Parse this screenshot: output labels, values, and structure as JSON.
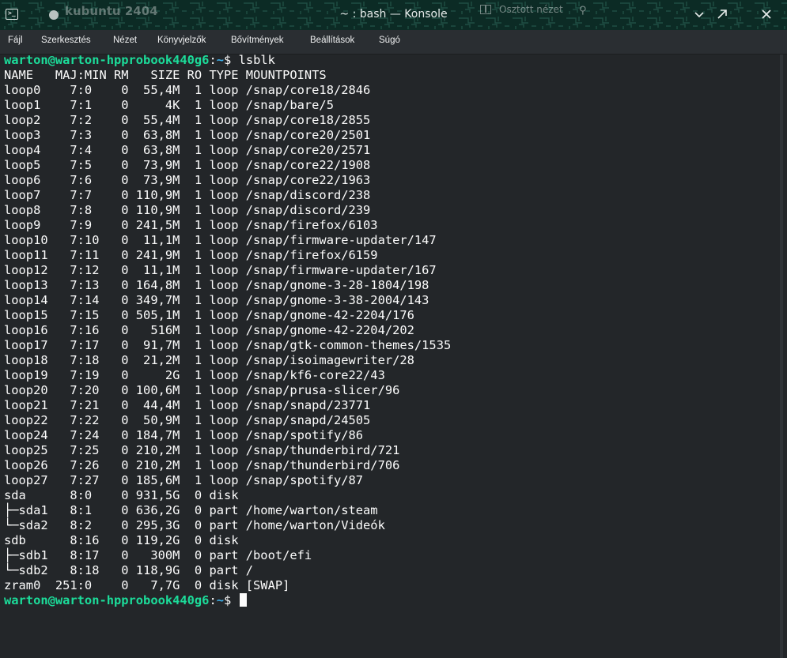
{
  "titlebar": {
    "ghost_text": "kubuntu 2404",
    "title": "~ : bash — Konsole",
    "split_view_label": "Osztott nézet"
  },
  "menu": {
    "items": [
      "Fájl",
      "Szerkesztés",
      "Nézet",
      "Könyvjelzők",
      "Bővítmények",
      "Beállítások",
      "Súgó"
    ]
  },
  "terminal": {
    "prompt_user": "warton@warton-hpprobook440g6",
    "prompt_path": "~",
    "prompt_symbol": "$",
    "command": "lsblk",
    "output": [
      "NAME   MAJ:MIN RM   SIZE RO TYPE MOUNTPOINTS",
      "loop0    7:0    0  55,4M  1 loop /snap/core18/2846",
      "loop1    7:1    0     4K  1 loop /snap/bare/5",
      "loop2    7:2    0  55,4M  1 loop /snap/core18/2855",
      "loop3    7:3    0  63,8M  1 loop /snap/core20/2501",
      "loop4    7:4    0  63,8M  1 loop /snap/core20/2571",
      "loop5    7:5    0  73,9M  1 loop /snap/core22/1908",
      "loop6    7:6    0  73,9M  1 loop /snap/core22/1963",
      "loop7    7:7    0 110,9M  1 loop /snap/discord/238",
      "loop8    7:8    0 110,9M  1 loop /snap/discord/239",
      "loop9    7:9    0 241,5M  1 loop /snap/firefox/6103",
      "loop10   7:10   0  11,1M  1 loop /snap/firmware-updater/147",
      "loop11   7:11   0 241,9M  1 loop /snap/firefox/6159",
      "loop12   7:12   0  11,1M  1 loop /snap/firmware-updater/167",
      "loop13   7:13   0 164,8M  1 loop /snap/gnome-3-28-1804/198",
      "loop14   7:14   0 349,7M  1 loop /snap/gnome-3-38-2004/143",
      "loop15   7:15   0 505,1M  1 loop /snap/gnome-42-2204/176",
      "loop16   7:16   0   516M  1 loop /snap/gnome-42-2204/202",
      "loop17   7:17   0  91,7M  1 loop /snap/gtk-common-themes/1535",
      "loop18   7:18   0  21,2M  1 loop /snap/isoimagewriter/28",
      "loop19   7:19   0     2G  1 loop /snap/kf6-core22/43",
      "loop20   7:20   0 100,6M  1 loop /snap/prusa-slicer/96",
      "loop21   7:21   0  44,4M  1 loop /snap/snapd/23771",
      "loop22   7:22   0  50,9M  1 loop /snap/snapd/24505",
      "loop24   7:24   0 184,7M  1 loop /snap/spotify/86",
      "loop25   7:25   0 210,2M  1 loop /snap/thunderbird/721",
      "loop26   7:26   0 210,2M  1 loop /snap/thunderbird/706",
      "loop27   7:27   0 185,6M  1 loop /snap/spotify/87",
      "sda      8:0    0 931,5G  0 disk",
      "├─sda1   8:1    0 636,2G  0 part /home/warton/steam",
      "└─sda2   8:2    0 295,3G  0 part /home/warton/Videók",
      "sdb      8:16   0 119,2G  0 disk",
      "├─sdb1   8:17   0   300M  0 part /boot/efi",
      "└─sdb2   8:18   0 118,9G  0 part /",
      "zram0  251:0    0   7,7G  0 disk [SWAP]"
    ]
  },
  "colors": {
    "titlebar_bg": "#0c2b25",
    "terminal_bg": "#232629",
    "prompt_user": "#1cdc9a",
    "prompt_path": "#3daee9",
    "text": "#fcfcfc"
  }
}
